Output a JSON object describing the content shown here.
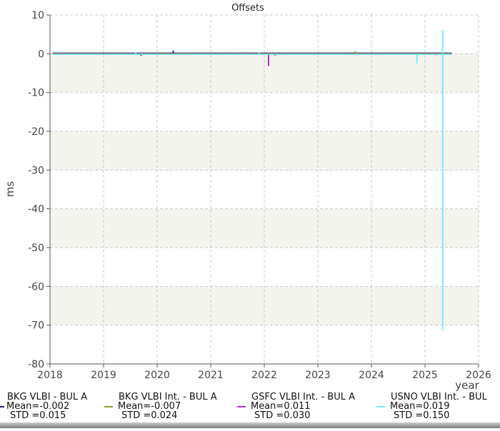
{
  "chart_data": {
    "type": "line",
    "title": "Offsets",
    "ylabel": "ms",
    "xlabel": "year",
    "xlim": [
      2018,
      2026
    ],
    "ylim": [
      -80,
      10
    ],
    "xticks": [
      2018,
      2019,
      2020,
      2021,
      2022,
      2023,
      2024,
      2025,
      2026
    ],
    "yticks": [
      10,
      0,
      -10,
      -20,
      -30,
      -40,
      -50,
      -60,
      -70,
      -80
    ],
    "grid": true,
    "legend_position": "bottom",
    "series": [
      {
        "name": "BKG VLBI - BUL A",
        "mean": "Mean=-0.002",
        "std": "STD =0.015",
        "color": "#1a1a7a",
        "spikes": [
          [
            2018.4,
            -0.3
          ],
          [
            2019.7,
            -0.5
          ],
          [
            2020.3,
            0.8
          ],
          [
            2021.2,
            -0.2
          ],
          [
            2023.5,
            0.3
          ],
          [
            2024.6,
            -0.2
          ]
        ]
      },
      {
        "name": "BKG VLBI Int. - BUL A",
        "mean": "Mean=-0.007",
        "std": "STD =0.024",
        "color": "#8fa020",
        "spikes": [
          [
            2018.9,
            -0.3
          ],
          [
            2020.6,
            0.3
          ],
          [
            2022.2,
            -0.6
          ],
          [
            2023.7,
            0.6
          ],
          [
            2024.3,
            -0.3
          ]
        ]
      },
      {
        "name": "GSFC VLBI Int. - BUL A",
        "mean": "Mean=0.011",
        "std": "STD =0.030",
        "color": "#b030c0",
        "spikes": [
          [
            2019.5,
            -0.2
          ],
          [
            2021.6,
            0.2
          ],
          [
            2022.08,
            -3.2
          ],
          [
            2023.9,
            -0.2
          ],
          [
            2025.2,
            -0.4
          ]
        ]
      },
      {
        "name": "USNO VLBI Int. - BUL",
        "mean": "Mean=0.019",
        "std": "STD =0.150",
        "color": "#70f0f0",
        "spikes": [
          [
            2019.6,
            0.4
          ],
          [
            2021.9,
            0.3
          ],
          [
            2024.85,
            -2.5
          ],
          [
            2025.33,
            6.1
          ],
          [
            2025.33,
            -71.3
          ]
        ]
      }
    ]
  }
}
